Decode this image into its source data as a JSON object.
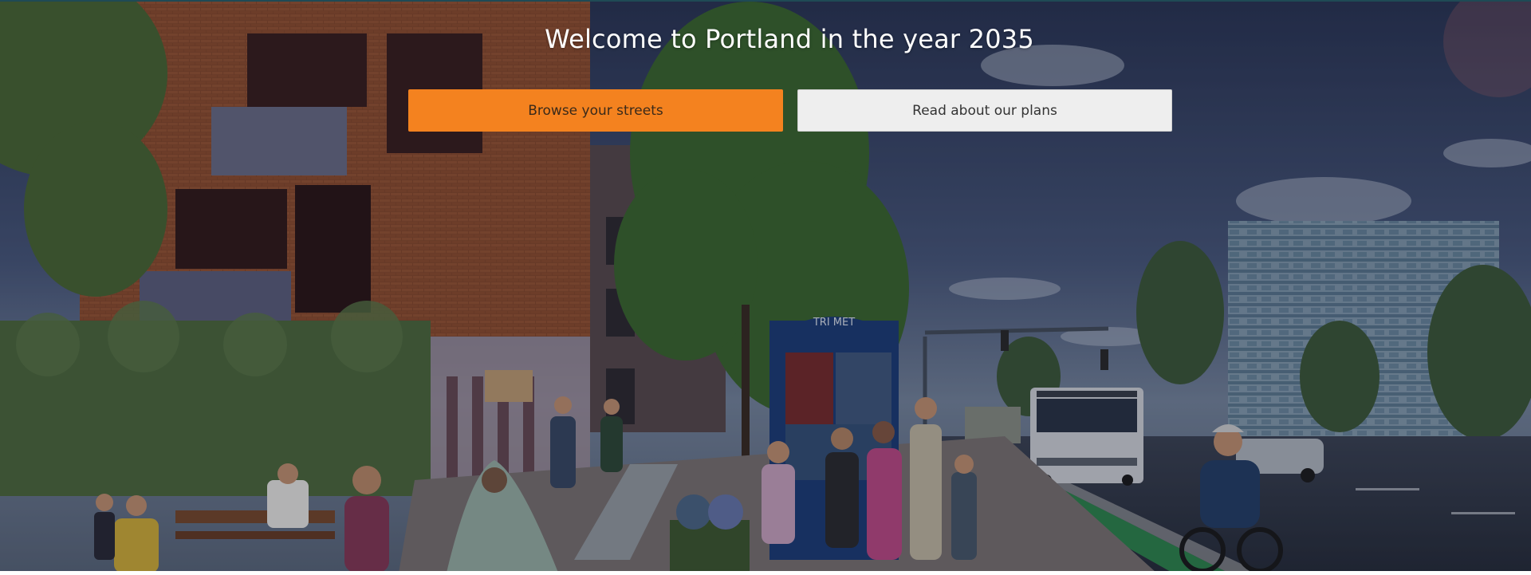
{
  "hero": {
    "title": "Welcome to Portland in the year 2035",
    "primary_button": "Browse your streets",
    "secondary_button": "Read about our plans"
  },
  "scene": {
    "bus_shelter_sign": "TRI MET"
  },
  "colors": {
    "primary_accent": "#f4821f",
    "secondary_button_bg": "#eeeeee",
    "title_text": "#ffffff",
    "bike_lane": "#2f8a4e"
  }
}
